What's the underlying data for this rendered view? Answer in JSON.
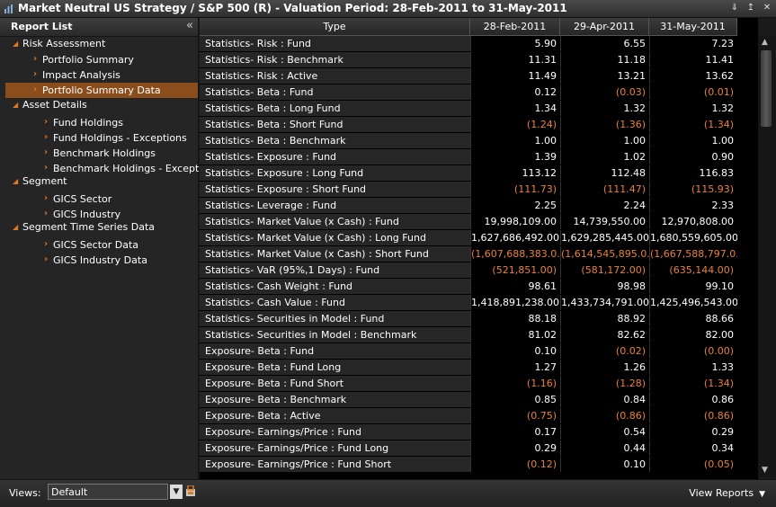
{
  "window": {
    "title": "Market Neutral US Strategy / S&P 500 (R) - Valuation Period: 28-Feb-2011 to 31-May-2011",
    "pin_glyph": "⇓",
    "dock_glyph": "↥",
    "close_glyph": "✕"
  },
  "report_list": {
    "header": "Report List",
    "collapse_glyph": "«",
    "items": [
      {
        "label": "Risk Assessment",
        "level": 0
      },
      {
        "label": "Portfolio Summary",
        "level": 1
      },
      {
        "label": "Impact Analysis",
        "level": 1
      },
      {
        "label": "Portfolio Summary Data",
        "level": 1,
        "selected": true
      },
      {
        "label": "Asset Details",
        "level": 0
      },
      {
        "label": "Fund Holdings",
        "level": 1
      },
      {
        "label": "Fund Holdings - Exceptions",
        "level": 1
      },
      {
        "label": "Benchmark Holdings",
        "level": 1
      },
      {
        "label": "Benchmark Holdings - Exceptions",
        "level": 1
      },
      {
        "label": "Segment",
        "level": 0
      },
      {
        "label": "GICS Sector",
        "level": 1
      },
      {
        "label": "GICS Industry",
        "level": 1
      },
      {
        "label": "Segment Time Series Data",
        "level": 0
      },
      {
        "label": "GICS Sector Data",
        "level": 1
      },
      {
        "label": "GICS Industry Data",
        "level": 1
      }
    ]
  },
  "grid": {
    "columns": [
      "Type",
      "28-Feb-2011",
      "29-Apr-2011",
      "31-May-2011"
    ],
    "rows": [
      {
        "type": "Statistics- Risk : Fund",
        "v": [
          "5.90",
          "6.55",
          "7.23"
        ]
      },
      {
        "type": "Statistics- Risk : Benchmark",
        "v": [
          "11.31",
          "11.18",
          "11.41"
        ]
      },
      {
        "type": "Statistics- Risk : Active",
        "v": [
          "11.49",
          "13.21",
          "13.62"
        ]
      },
      {
        "type": "Statistics- Beta : Fund",
        "v": [
          "0.12",
          "(0.03)",
          "(0.01)"
        ]
      },
      {
        "type": "Statistics- Beta : Long Fund",
        "v": [
          "1.34",
          "1.32",
          "1.32"
        ]
      },
      {
        "type": "Statistics- Beta : Short Fund",
        "v": [
          "(1.24)",
          "(1.36)",
          "(1.34)"
        ]
      },
      {
        "type": "Statistics- Beta : Benchmark",
        "v": [
          "1.00",
          "1.00",
          "1.00"
        ]
      },
      {
        "type": "Statistics- Exposure : Fund",
        "v": [
          "1.39",
          "1.02",
          "0.90"
        ]
      },
      {
        "type": "Statistics- Exposure : Long Fund",
        "v": [
          "113.12",
          "112.48",
          "116.83"
        ]
      },
      {
        "type": "Statistics- Exposure : Short Fund",
        "v": [
          "(111.73)",
          "(111.47)",
          "(115.93)"
        ]
      },
      {
        "type": "Statistics- Leverage : Fund",
        "v": [
          "2.25",
          "2.24",
          "2.33"
        ]
      },
      {
        "type": "Statistics- Market Value (x Cash) : Fund",
        "v": [
          "19,998,109.00",
          "14,739,550.00",
          "12,970,808.00"
        ]
      },
      {
        "type": "Statistics- Market Value (x Cash) : Long Fund",
        "v": [
          "1,627,686,492.00",
          "1,629,285,445.00",
          "1,680,559,605.00"
        ]
      },
      {
        "type": "Statistics- Market Value (x Cash) : Short Fund",
        "v": [
          "(1,607,688,383.0...",
          "(1,614,545,895.0...",
          "(1,667,588,797.0..."
        ]
      },
      {
        "type": "Statistics- VaR (95%,1 Days) : Fund",
        "v": [
          "(521,851.00)",
          "(581,172.00)",
          "(635,144.00)"
        ]
      },
      {
        "type": "Statistics- Cash Weight : Fund",
        "v": [
          "98.61",
          "98.98",
          "99.10"
        ]
      },
      {
        "type": "Statistics- Cash Value : Fund",
        "v": [
          "1,418,891,238.00",
          "1,433,734,791.00",
          "1,425,496,543.00"
        ]
      },
      {
        "type": "Statistics- Securities in Model : Fund",
        "v": [
          "88.18",
          "88.92",
          "88.66"
        ]
      },
      {
        "type": "Statistics- Securities in Model : Benchmark",
        "v": [
          "81.02",
          "82.62",
          "82.00"
        ]
      },
      {
        "type": "Exposure- Beta : Fund",
        "v": [
          "0.10",
          "(0.02)",
          "(0.00)"
        ]
      },
      {
        "type": "Exposure- Beta : Fund Long",
        "v": [
          "1.27",
          "1.26",
          "1.33"
        ]
      },
      {
        "type": "Exposure- Beta : Fund Short",
        "v": [
          "(1.16)",
          "(1.28)",
          "(1.34)"
        ]
      },
      {
        "type": "Exposure- Beta : Benchmark",
        "v": [
          "0.85",
          "0.84",
          "0.86"
        ]
      },
      {
        "type": "Exposure- Beta : Active",
        "v": [
          "(0.75)",
          "(0.86)",
          "(0.86)"
        ]
      },
      {
        "type": "Exposure- Earnings/Price : Fund",
        "v": [
          "0.17",
          "0.54",
          "0.29"
        ]
      },
      {
        "type": "Exposure- Earnings/Price : Fund Long",
        "v": [
          "0.29",
          "0.44",
          "0.34"
        ]
      },
      {
        "type": "Exposure- Earnings/Price : Fund Short",
        "v": [
          "(0.12)",
          "0.10",
          "(0.05)"
        ]
      }
    ]
  },
  "bottom": {
    "views_label": "Views:",
    "views_value": "Default",
    "view_reports_label": "View Reports"
  },
  "colors": {
    "accent": "#e07820",
    "negative": "#e8803a",
    "selected": "#8a4e1c"
  }
}
